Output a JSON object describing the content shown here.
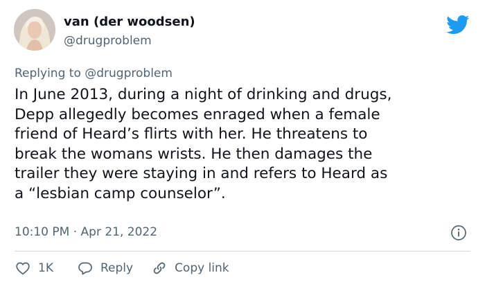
{
  "author": {
    "display_name": "van (der woodsen)",
    "handle": "@drugproblem"
  },
  "reply_context": {
    "prefix": "Replying to",
    "mention": "@drugproblem"
  },
  "body_lines": [
    "In June 2013, during a night of drinking and drugs,",
    "Depp allegedly becomes enraged when a female",
    "friend of Heard’s flirts with her. He threatens to",
    "break the womans wrists. He then damages the",
    "trailer they were staying in and refers to Heard as",
    "a “lesbian camp counselor”."
  ],
  "meta": {
    "time": "10:10 PM",
    "separator": "·",
    "date": "Apr 21, 2022"
  },
  "actions": {
    "like_count": "1K",
    "reply_label": "Reply",
    "copy_link_label": "Copy link"
  },
  "icons": {
    "logo": "twitter-bird-icon",
    "info": "info-icon",
    "like": "heart-icon",
    "reply": "speech-bubble-icon",
    "copy_link": "link-icon"
  },
  "colors": {
    "brand": "#1d9bf0",
    "secondary_text": "#536471",
    "primary_text": "#0f1419",
    "divider": "#cfd9de"
  }
}
